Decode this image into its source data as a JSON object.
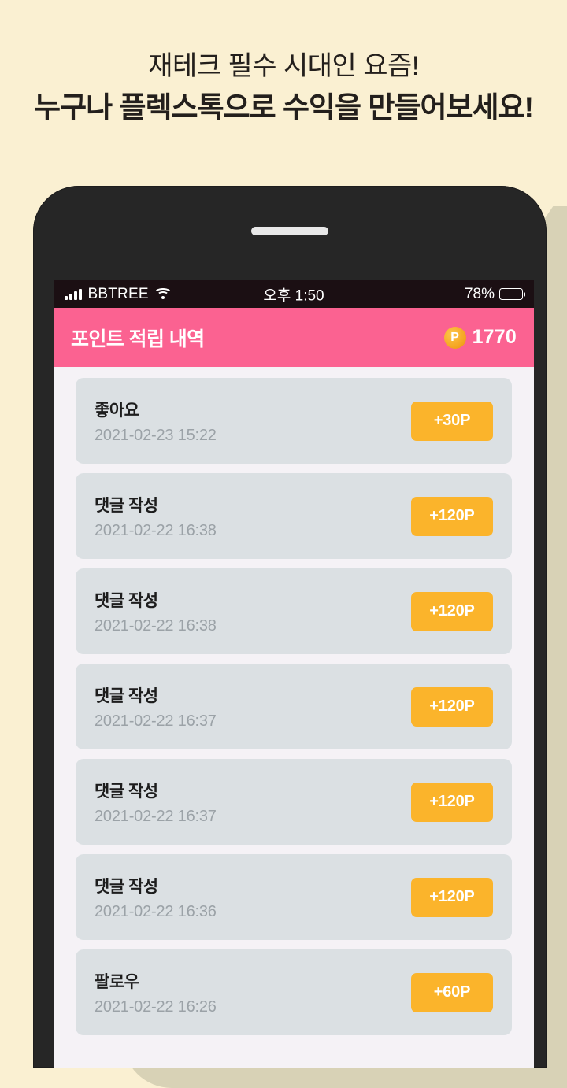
{
  "promo": {
    "line1": "재테크 필수 시대인 요즘!",
    "line2": "누구나 플렉스톡으로 수익을 만들어보세요!"
  },
  "colors": {
    "page_background": "#faf0d2",
    "shadow": "#d8d2b6",
    "phone_body": "#262626",
    "screen_background": "#f5f2f6",
    "header_pink": "#fb6291",
    "card_gray": "#dbe0e3",
    "amount_orange": "#fbb42b",
    "coin_orange": "#f5a623",
    "title_text": "#1d1d1d",
    "date_text": "#9ba2a7"
  },
  "status_bar": {
    "carrier": "BBTREE",
    "time": "오후 1:50",
    "battery_percent": "78%",
    "battery_level": 78,
    "signal_icon": "signal-bars-icon",
    "wifi_icon": "wifi-icon",
    "battery_icon": "battery-icon"
  },
  "app_header": {
    "title": "포인트 적립 내역",
    "coin_icon_label": "P",
    "point_value": "1770"
  },
  "list": {
    "rows": [
      {
        "title": "좋아요",
        "date": "2021-02-23 15:22",
        "amount": "+30P"
      },
      {
        "title": "댓글 작성",
        "date": "2021-02-22 16:38",
        "amount": "+120P"
      },
      {
        "title": "댓글 작성",
        "date": "2021-02-22 16:38",
        "amount": "+120P"
      },
      {
        "title": "댓글 작성",
        "date": "2021-02-22 16:37",
        "amount": "+120P"
      },
      {
        "title": "댓글 작성",
        "date": "2021-02-22 16:37",
        "amount": "+120P"
      },
      {
        "title": "댓글 작성",
        "date": "2021-02-22 16:36",
        "amount": "+120P"
      },
      {
        "title": "팔로우",
        "date": "2021-02-22 16:26",
        "amount": "+60P"
      }
    ]
  }
}
